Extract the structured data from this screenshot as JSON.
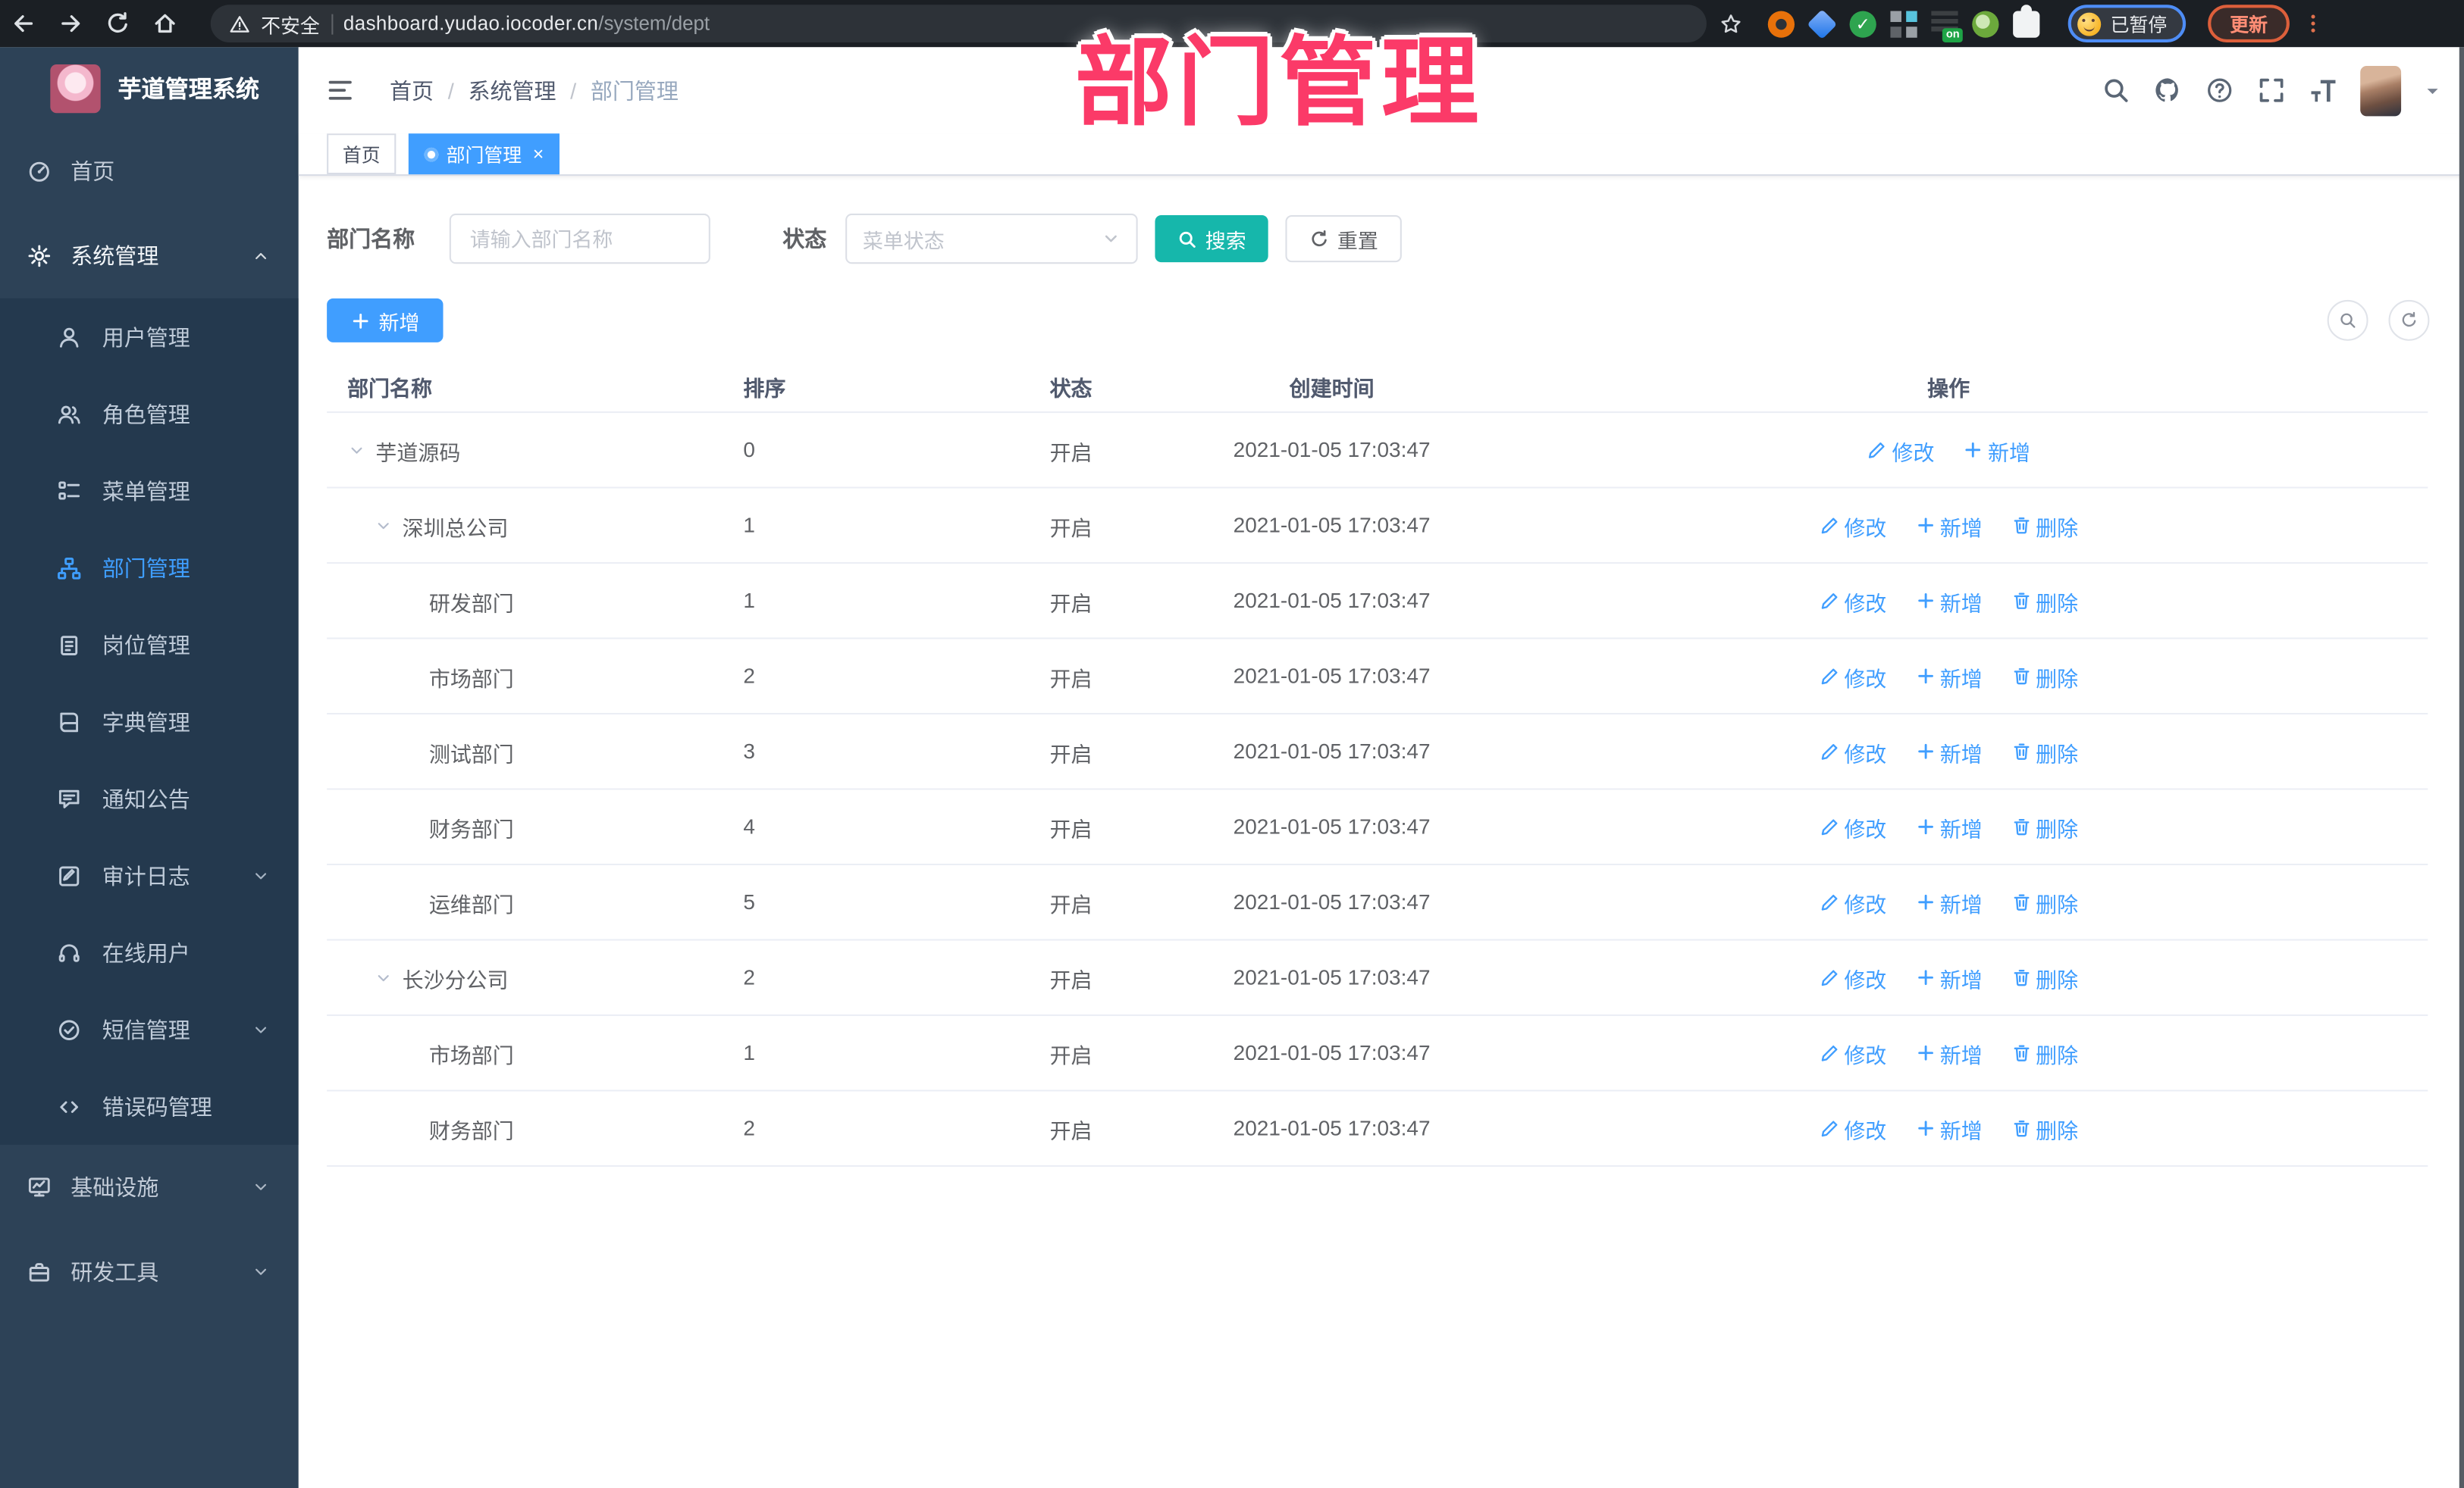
{
  "watermark": "部门管理",
  "browser": {
    "security_label": "不安全",
    "url_host": "dashboard.yudao.iocoder.cn",
    "url_path": "/system/dept",
    "profile_label": "已暂停",
    "update_label": "更新"
  },
  "sidebar": {
    "logo_title": "芋道管理系统",
    "items": [
      {
        "label": "首页",
        "icon": "dashboard",
        "kind": "top",
        "chevron": null,
        "active": false,
        "open": false
      },
      {
        "label": "系统管理",
        "icon": "gear",
        "kind": "top",
        "chevron": "up",
        "active": false,
        "open": true
      },
      {
        "label": "用户管理",
        "icon": "user",
        "kind": "sub",
        "chevron": null,
        "active": false
      },
      {
        "label": "角色管理",
        "icon": "users",
        "kind": "sub",
        "chevron": null,
        "active": false
      },
      {
        "label": "菜单管理",
        "icon": "menutree",
        "kind": "sub",
        "chevron": null,
        "active": false
      },
      {
        "label": "部门管理",
        "icon": "org",
        "kind": "sub",
        "chevron": null,
        "active": true
      },
      {
        "label": "岗位管理",
        "icon": "badge",
        "kind": "sub",
        "chevron": null,
        "active": false
      },
      {
        "label": "字典管理",
        "icon": "book",
        "kind": "sub",
        "chevron": null,
        "active": false
      },
      {
        "label": "通知公告",
        "icon": "bubble",
        "kind": "sub",
        "chevron": null,
        "active": false
      },
      {
        "label": "审计日志",
        "icon": "log",
        "kind": "sub",
        "chevron": "down",
        "active": false
      },
      {
        "label": "在线用户",
        "icon": "headset",
        "kind": "sub",
        "chevron": null,
        "active": false
      },
      {
        "label": "短信管理",
        "icon": "sms",
        "kind": "sub",
        "chevron": "down",
        "active": false
      },
      {
        "label": "错误码管理",
        "icon": "code",
        "kind": "sub",
        "chevron": null,
        "active": false
      },
      {
        "label": "基础设施",
        "icon": "infra",
        "kind": "top",
        "chevron": "down",
        "active": false,
        "open": false
      },
      {
        "label": "研发工具",
        "icon": "tools",
        "kind": "top",
        "chevron": "down",
        "active": false,
        "open": false
      }
    ]
  },
  "header": {
    "breadcrumb": [
      "首页",
      "系统管理",
      "部门管理"
    ],
    "right_icons": [
      "search",
      "github",
      "help",
      "fullscreen",
      "fontsize"
    ]
  },
  "tabs": [
    {
      "label": "首页",
      "active": false,
      "closable": false
    },
    {
      "label": "部门管理",
      "active": true,
      "closable": true
    }
  ],
  "filters": {
    "name_label": "部门名称",
    "name_placeholder": "请输入部门名称",
    "status_label": "状态",
    "status_placeholder": "菜单状态",
    "search_label": "搜索",
    "reset_label": "重置"
  },
  "toolbar": {
    "add_label": "新增"
  },
  "table": {
    "columns": [
      "部门名称",
      "排序",
      "状态",
      "创建时间",
      "操作"
    ],
    "action_labels": {
      "edit": "修改",
      "add": "新增",
      "delete": "删除"
    },
    "rows": [
      {
        "name": "芋道源码",
        "level": 0,
        "expandable": true,
        "sort": "0",
        "status": "开启",
        "created": "2021-01-05 17:03:47",
        "actions": [
          "edit",
          "add"
        ]
      },
      {
        "name": "深圳总公司",
        "level": 1,
        "expandable": true,
        "sort": "1",
        "status": "开启",
        "created": "2021-01-05 17:03:47",
        "actions": [
          "edit",
          "add",
          "delete"
        ]
      },
      {
        "name": "研发部门",
        "level": 2,
        "expandable": false,
        "sort": "1",
        "status": "开启",
        "created": "2021-01-05 17:03:47",
        "actions": [
          "edit",
          "add",
          "delete"
        ]
      },
      {
        "name": "市场部门",
        "level": 2,
        "expandable": false,
        "sort": "2",
        "status": "开启",
        "created": "2021-01-05 17:03:47",
        "actions": [
          "edit",
          "add",
          "delete"
        ]
      },
      {
        "name": "测试部门",
        "level": 2,
        "expandable": false,
        "sort": "3",
        "status": "开启",
        "created": "2021-01-05 17:03:47",
        "actions": [
          "edit",
          "add",
          "delete"
        ]
      },
      {
        "name": "财务部门",
        "level": 2,
        "expandable": false,
        "sort": "4",
        "status": "开启",
        "created": "2021-01-05 17:03:47",
        "actions": [
          "edit",
          "add",
          "delete"
        ]
      },
      {
        "name": "运维部门",
        "level": 2,
        "expandable": false,
        "sort": "5",
        "status": "开启",
        "created": "2021-01-05 17:03:47",
        "actions": [
          "edit",
          "add",
          "delete"
        ]
      },
      {
        "name": "长沙分公司",
        "level": 1,
        "expandable": true,
        "sort": "2",
        "status": "开启",
        "created": "2021-01-05 17:03:47",
        "actions": [
          "edit",
          "add",
          "delete"
        ]
      },
      {
        "name": "市场部门",
        "level": 2,
        "expandable": false,
        "sort": "1",
        "status": "开启",
        "created": "2021-01-05 17:03:47",
        "actions": [
          "edit",
          "add",
          "delete"
        ]
      },
      {
        "name": "财务部门",
        "level": 2,
        "expandable": false,
        "sort": "2",
        "status": "开启",
        "created": "2021-01-05 17:03:47",
        "actions": [
          "edit",
          "add",
          "delete"
        ]
      }
    ]
  },
  "colors": {
    "accent_blue": "#409eff",
    "search_teal": "#16b7ab",
    "watermark_pink": "#fb3a68",
    "sidebar_bg": "#2d4257",
    "submenu_bg": "#24394e",
    "browser_bar": "#1b1f24"
  }
}
